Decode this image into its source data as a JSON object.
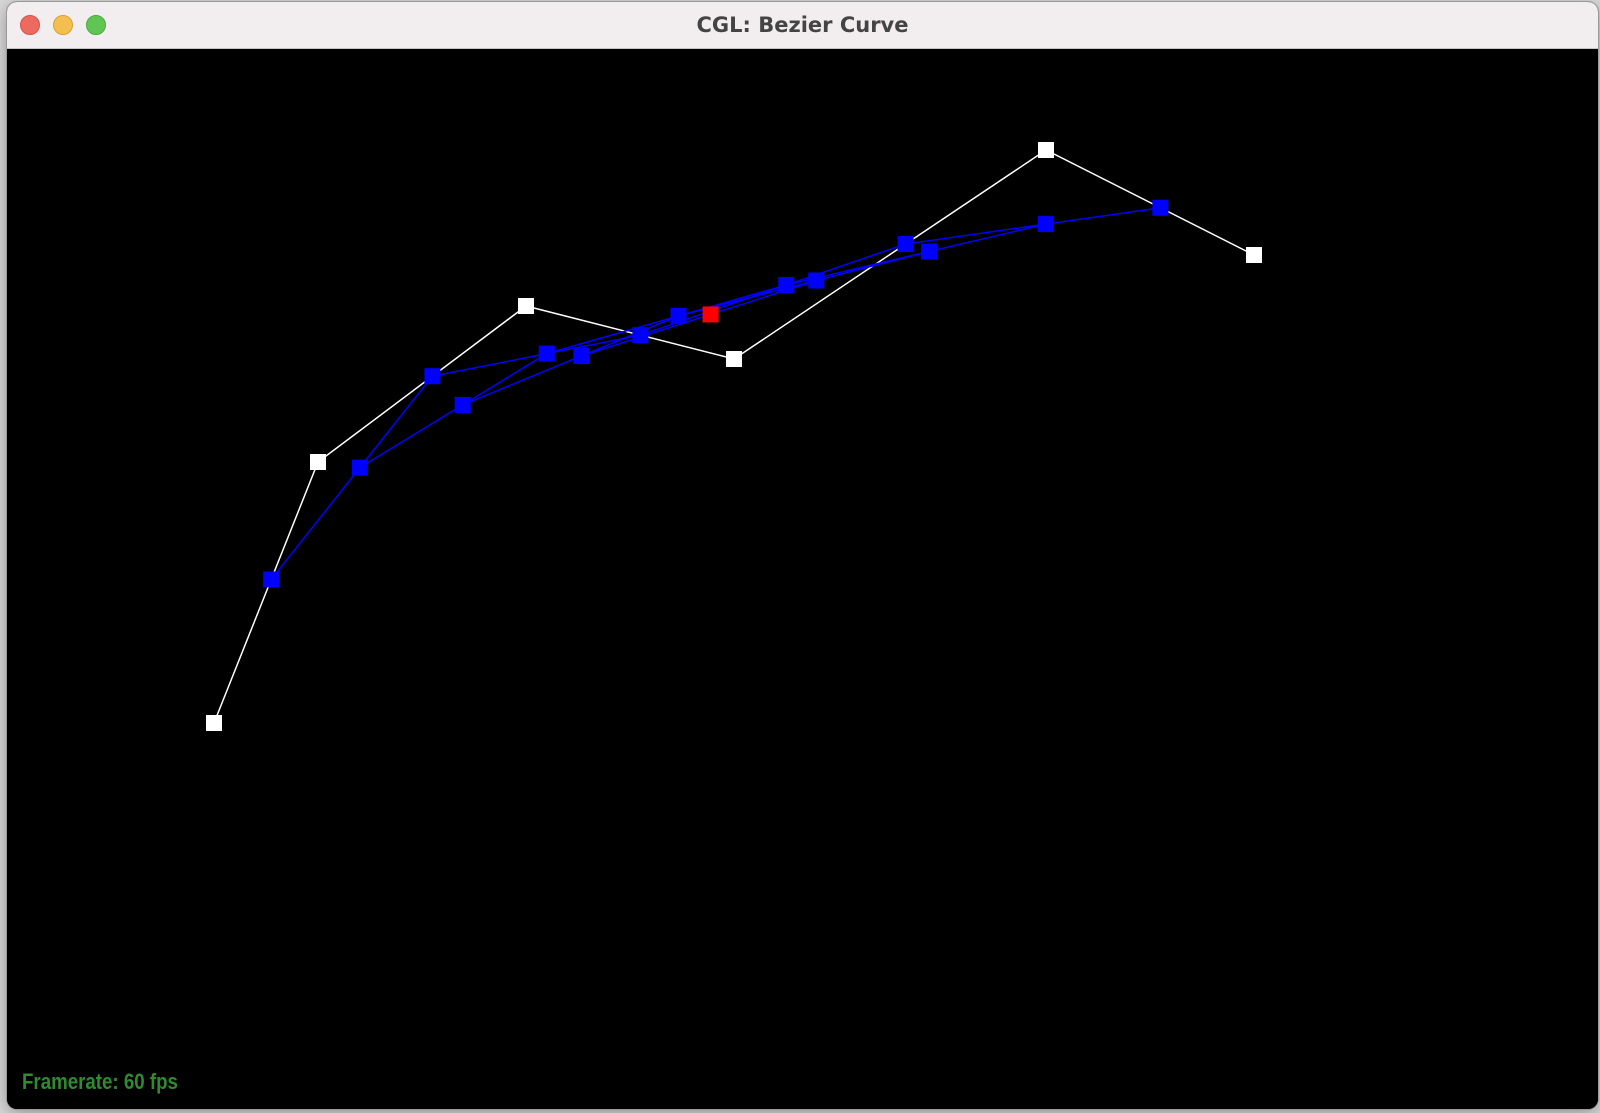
{
  "window": {
    "title": "CGL: Bezier Curve",
    "traffic_lights": {
      "close": "close-icon",
      "minimize": "minimize-icon",
      "maximize": "maximize-icon"
    }
  },
  "status": {
    "framerate": "Framerate: 60 fps"
  },
  "colors": {
    "control_polygon": "#ffffff",
    "intermediate": "#0000ff",
    "evaluated_point": "#ff0000",
    "framerate_text": "#2e8b2e",
    "background": "#000000"
  }
}
